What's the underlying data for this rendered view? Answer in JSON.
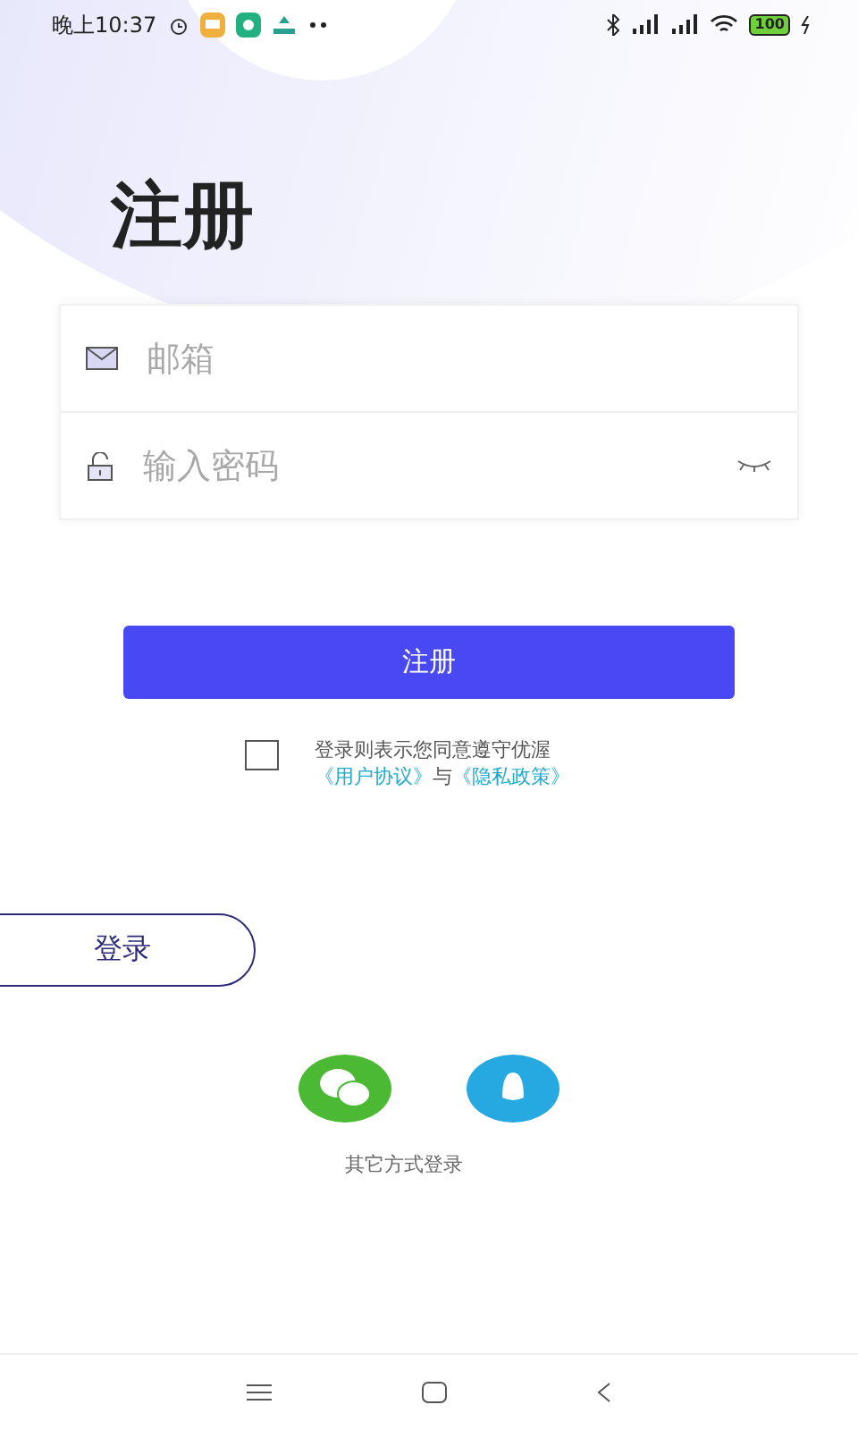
{
  "status_bar": {
    "time": "晚上10:37",
    "battery": "100"
  },
  "title": "注册",
  "form": {
    "email": {
      "placeholder": "邮箱"
    },
    "password": {
      "placeholder": "输入密码"
    }
  },
  "submit_button": "注册",
  "agreement": {
    "checked": false,
    "text": "登录则表示您同意遵守优渥",
    "user_agreement": "《用户协议》",
    "joiner": "与",
    "privacy_policy": "《隐私政策》"
  },
  "login_button": "登录",
  "other_login": "其它方式登录"
}
